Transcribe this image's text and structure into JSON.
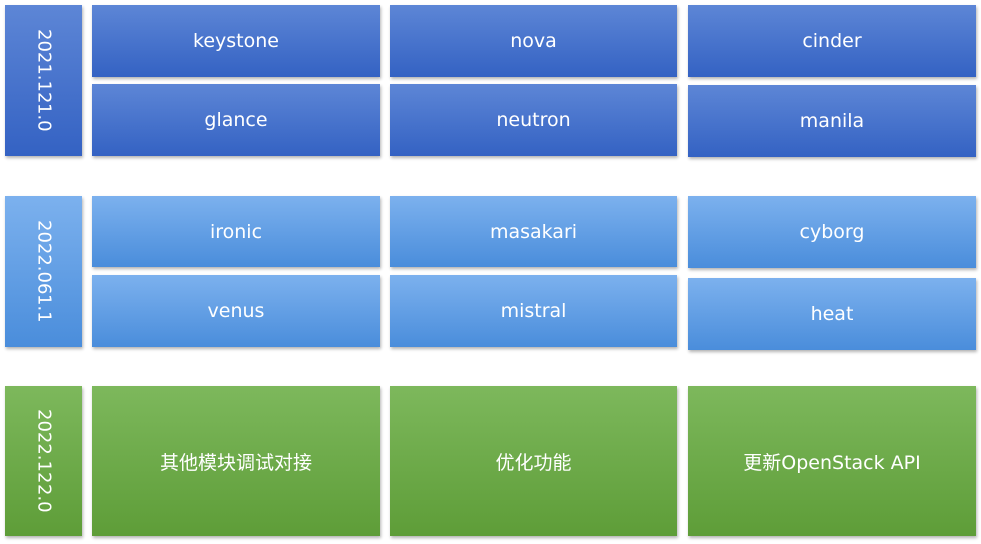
{
  "rows": [
    {
      "version": "1.0",
      "date": "2021.12",
      "items": [
        "keystone",
        "nova",
        "cinder",
        "glance",
        "neutron",
        "manila"
      ]
    },
    {
      "version": "1.1",
      "date": "2022.06",
      "items": [
        "ironic",
        "masakari",
        "cyborg",
        "venus",
        "mistral",
        "heat"
      ]
    },
    {
      "version": "2.0",
      "date": "2022.12",
      "items": [
        "其他模块调试对接",
        "优化功能",
        "更新OpenStack API"
      ]
    }
  ]
}
